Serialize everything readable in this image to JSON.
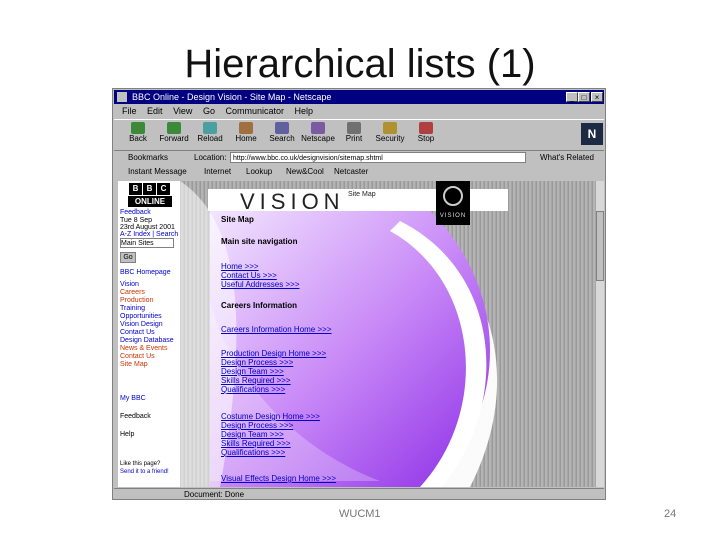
{
  "slide": {
    "title": "Hierarchical lists (1)",
    "footer": "WUCM1",
    "page": "24"
  },
  "browser": {
    "title": "BBC Online - Design Vision - Site Map - Netscape",
    "menu": [
      "File",
      "Edit",
      "View",
      "Go",
      "Communicator",
      "Help"
    ],
    "toolbar": [
      "Back",
      "Forward",
      "Reload",
      "Home",
      "Search",
      "Netscape",
      "Print",
      "Security",
      "Stop"
    ],
    "bookmarks_label": "Bookmarks",
    "location_label": "Location:",
    "url": "http://www.bbc.co.uk/designvision/sitemap.shtml",
    "related_label": "What's Related",
    "personal": [
      "Instant Message",
      "Internet",
      "Lookup",
      "New&Cool",
      "Netcaster"
    ],
    "status": "Document: Done"
  },
  "leftnav": {
    "bbc": [
      "B",
      "B",
      "C"
    ],
    "online": "ONLINE",
    "items_top": [
      "Feedback",
      "Tue 8 Sep",
      "23rd August 2001",
      "A-Z Index | Search"
    ],
    "select_value": "Main Sites",
    "go": "Go",
    "items": [
      "BBC Homepage",
      "Vision",
      "Careers",
      "Production",
      "Training",
      "Opportunities",
      "Vision Design",
      "Contact Us",
      "Design Database",
      "News & Events",
      "Contact Us",
      "Site Map",
      "My BBC",
      "Feedback",
      "Help",
      "Like this page?",
      "Send it to a friend!"
    ]
  },
  "main": {
    "vision": "VISION",
    "vision_sub": "Site Map",
    "logo_text": "VISION",
    "site_map": "Site Map",
    "nav_heading": "Main site navigation",
    "nav_links": [
      "Home >>>",
      "Contact Us >>>",
      "Useful Addresses >>>"
    ],
    "careers_heading": "Careers Information",
    "careers_home": "Careers Information Home >>>",
    "group1": [
      "Production Design Home >>>",
      "Design Process >>>",
      "Design Team >>>",
      "Skills Required >>>",
      "Qualifications >>>"
    ],
    "group2": [
      "Costume Design Home >>>",
      "Design Process >>>",
      "Design Team >>>",
      "Skills Required >>>",
      "Qualifications >>>"
    ],
    "last": "Visual Effects Design Home >>>"
  },
  "colors": {
    "titlebar": "#000080",
    "link": "#0000cc",
    "swirl": "#9b3ff0"
  }
}
